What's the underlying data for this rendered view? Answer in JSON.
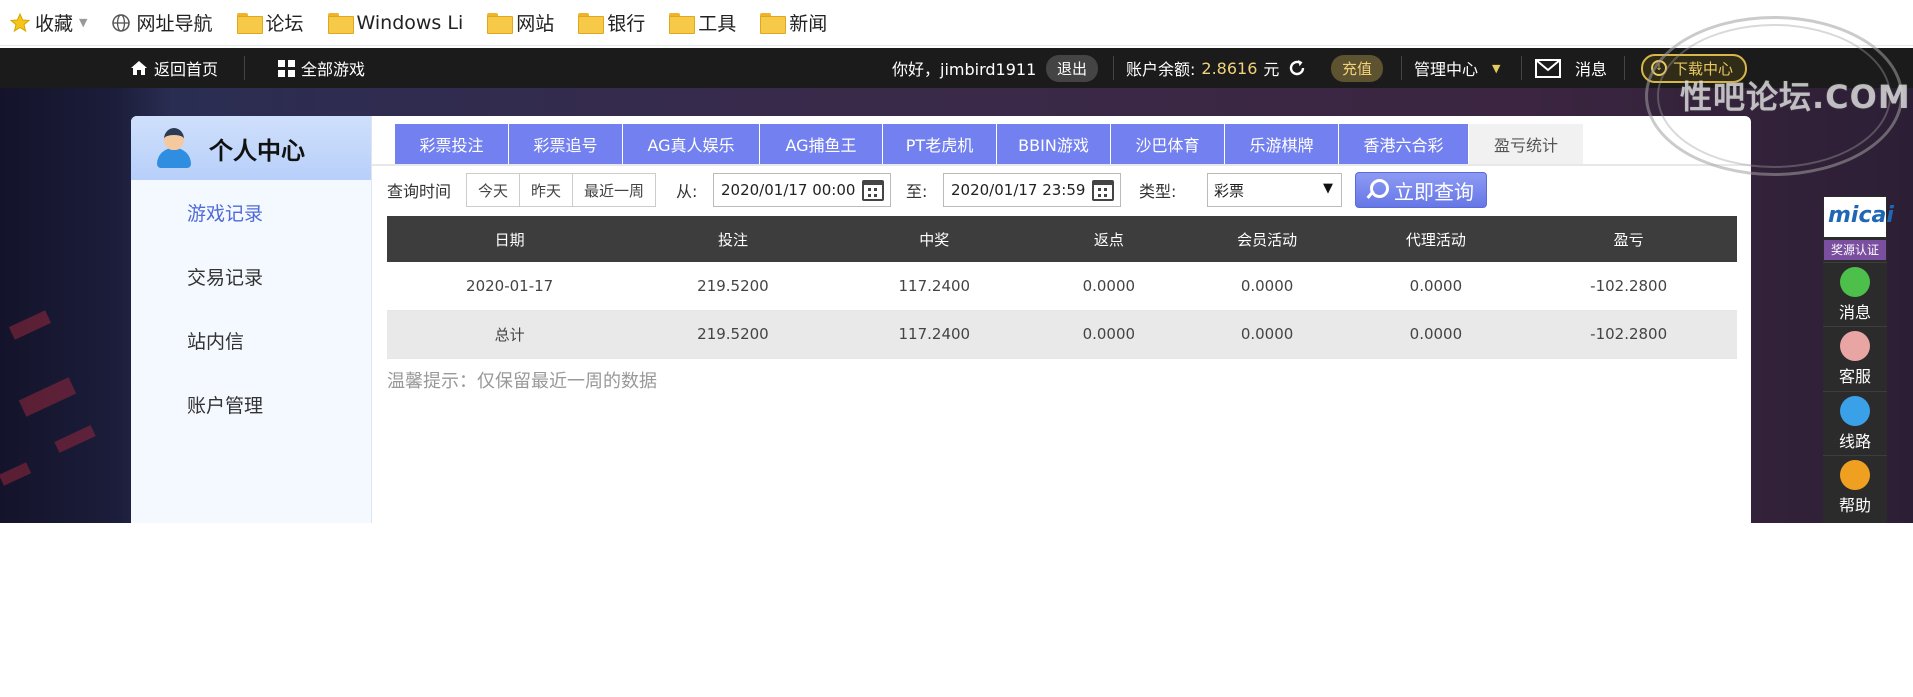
{
  "bookmarks": {
    "items": [
      {
        "label": "收藏",
        "icon": "star-icon"
      },
      {
        "label": "网址导航",
        "icon": "globe-icon"
      },
      {
        "label": "论坛",
        "icon": "folder-icon"
      },
      {
        "label": "Windows Li",
        "icon": "folder-icon"
      },
      {
        "label": "网站",
        "icon": "folder-icon"
      },
      {
        "label": "银行",
        "icon": "folder-icon"
      },
      {
        "label": "工具",
        "icon": "folder-icon"
      },
      {
        "label": "新闻",
        "icon": "folder-icon"
      }
    ]
  },
  "topbar": {
    "home": "返回首页",
    "all_games": "全部游戏",
    "greeting": "你好，jimbird1911",
    "logout": "退出",
    "balance_label": "账户余额:",
    "balance": "2.8616",
    "currency": "元",
    "recharge": "充值",
    "manage": "管理中心",
    "messages": "消息",
    "download": "下载中心"
  },
  "sidebar": {
    "title": "个人中心",
    "items": [
      "游戏记录",
      "交易记录",
      "站内信",
      "账户管理"
    ],
    "active_index": 0
  },
  "tabs": [
    "彩票投注",
    "彩票追号",
    "AG真人娱乐",
    "AG捕鱼王",
    "PT老虎机",
    "BBIN游戏",
    "沙巴体育",
    "乐游棋牌",
    "香港六合彩",
    "盈亏统计"
  ],
  "active_tab": 9,
  "filter": {
    "time_label": "查询时间",
    "quick": [
      "今天",
      "昨天",
      "最近一周"
    ],
    "from_label": "从:",
    "from_value": "2020/01/17 00:00",
    "to_label": "至:",
    "to_value": "2020/01/17 23:59",
    "type_label": "类型:",
    "type_value": "彩票",
    "query_button": "立即查询"
  },
  "table": {
    "headers": [
      "日期",
      "投注",
      "中奖",
      "返点",
      "会员活动",
      "代理活动",
      "盈亏"
    ],
    "rows": [
      [
        "2020-01-17",
        "219.5200",
        "117.2400",
        "0.0000",
        "0.0000",
        "0.0000",
        "-102.2800"
      ],
      [
        "总计",
        "219.5200",
        "117.2400",
        "0.0000",
        "0.0000",
        "0.0000",
        "-102.2800"
      ]
    ]
  },
  "tip": "温馨提示：仅保留最近一周的数据",
  "watermark": {
    "text": "性吧论坛.COM"
  },
  "float_bar": {
    "logo": "micai",
    "badge": "奖源认证",
    "items": [
      {
        "label": "消息",
        "icon": "chat-icon",
        "color": "#4cc04a"
      },
      {
        "label": "客服",
        "icon": "agent-icon",
        "color": "#e9a4a4"
      },
      {
        "label": "线路",
        "icon": "speed-icon",
        "color": "#3aa0e8"
      },
      {
        "label": "帮助",
        "icon": "help-icon",
        "color": "#f0a020"
      }
    ]
  },
  "colors": {
    "accent": "#7381f0",
    "balance": "#f1d27a",
    "active_nav": "#4f6bd8"
  }
}
